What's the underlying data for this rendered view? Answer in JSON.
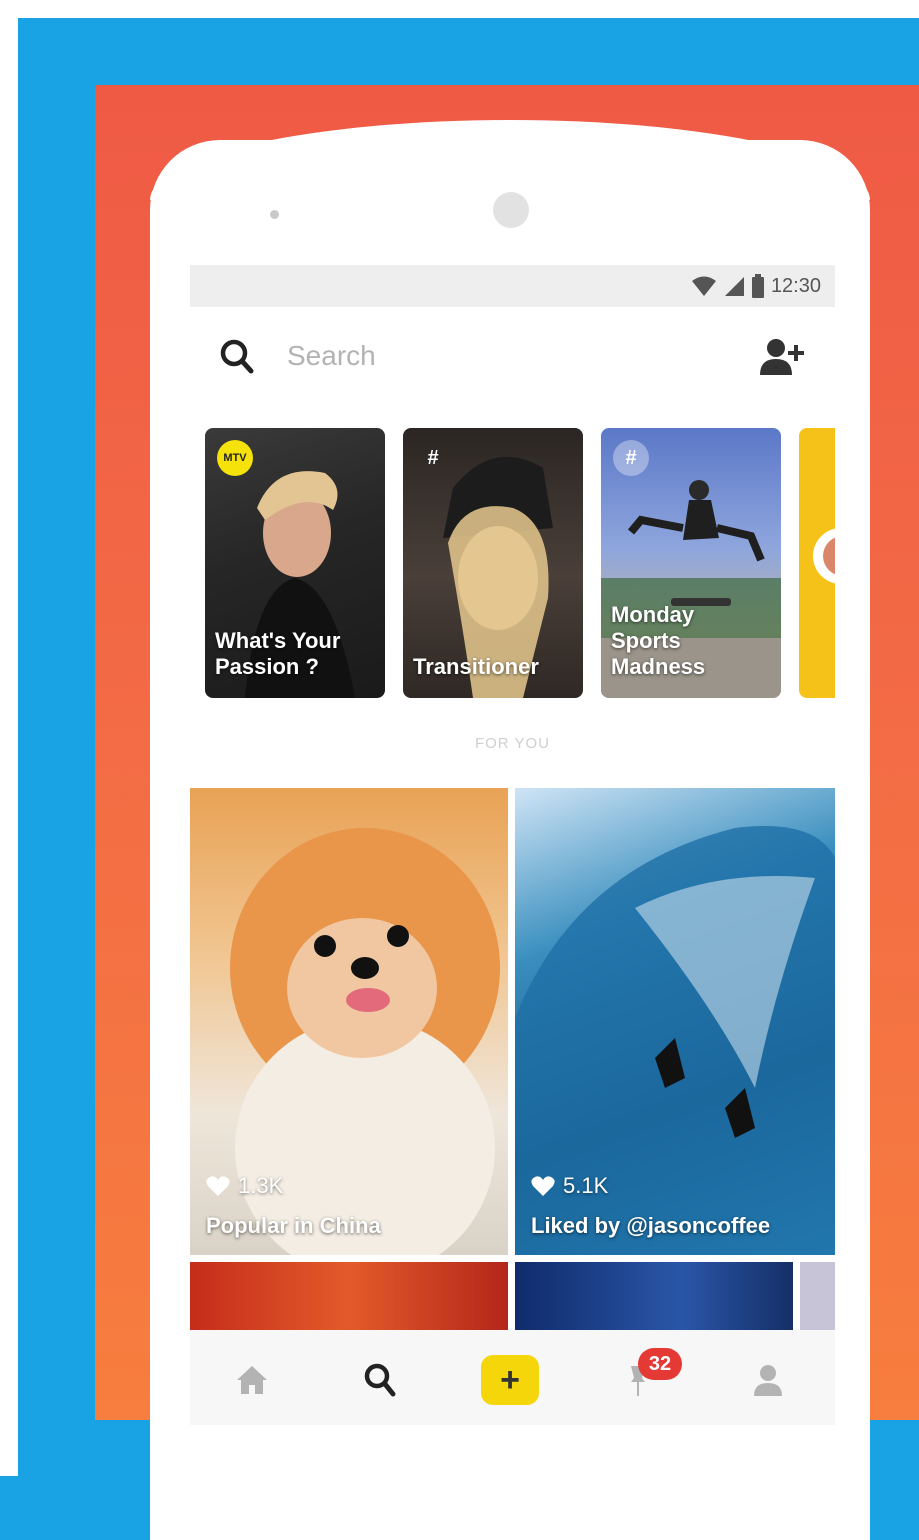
{
  "status_bar": {
    "time": "12:30"
  },
  "search": {
    "placeholder": "Search"
  },
  "stories": [
    {
      "label": "What's Your\nPassion ?",
      "badge": "MTV"
    },
    {
      "label": "Transitioner",
      "badge": "#"
    },
    {
      "label": "Monday\nSports\nMadness",
      "badge": "#"
    }
  ],
  "section_label": "FOR YOU",
  "feed": [
    {
      "likes": "1.3K",
      "caption": "Popular in China"
    },
    {
      "likes": "5.1K",
      "caption": "Liked by @jasoncoffee"
    }
  ],
  "bottom_nav": {
    "create_label": "+",
    "notification_count": "32"
  },
  "colors": {
    "background": "#1aa3e4",
    "panel": "#f36c45",
    "create_button": "#f5d60a",
    "badge": "#e53935"
  }
}
